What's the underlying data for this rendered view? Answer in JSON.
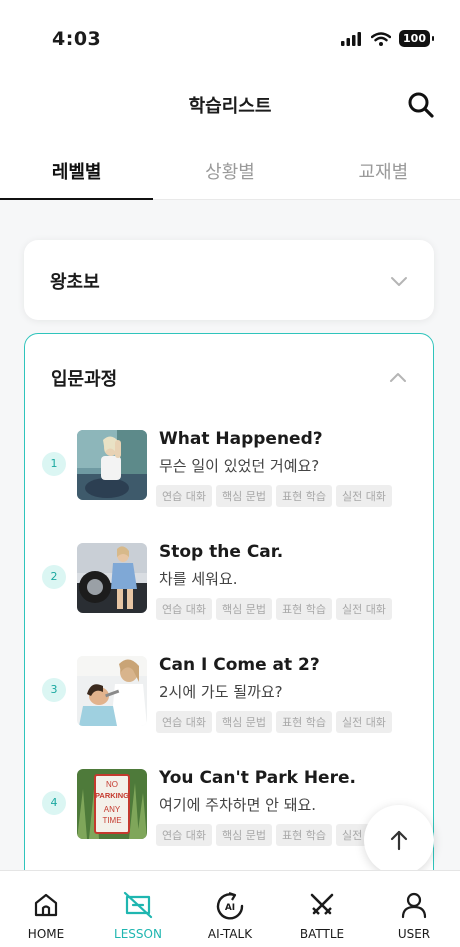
{
  "status_bar": {
    "time": "4:03",
    "battery": "100"
  },
  "header": {
    "title": "학습리스트",
    "search_icon": "search-icon"
  },
  "tabs": [
    {
      "label": "레벨별",
      "active": true
    },
    {
      "label": "상황별",
      "active": false
    },
    {
      "label": "교재별",
      "active": false
    }
  ],
  "sections": [
    {
      "title": "왕초보",
      "expanded": false,
      "icon": "chevron-down-icon"
    },
    {
      "title": "입문과정",
      "expanded": true,
      "icon": "chevron-up-icon"
    }
  ],
  "lessons": [
    {
      "number": "1",
      "title_en": "What Happened?",
      "title_ko": "무슨 일이 있었던 거예요?",
      "image": "woman-at-car-photo"
    },
    {
      "number": "2",
      "title_en": "Stop the Car.",
      "title_ko": "차를 세워요.",
      "image": "woman-by-tire-photo"
    },
    {
      "number": "3",
      "title_en": "Can I Come at 2?",
      "title_ko": "2시에 가도 될까요?",
      "image": "dentist-photo"
    },
    {
      "number": "4",
      "title_en": "You Can't Park Here.",
      "title_ko": "여기에 주차하면 안 돼요.",
      "image": "no-parking-sign-photo"
    }
  ],
  "tags": [
    "연습 대화",
    "핵심 문법",
    "표현 학습",
    "실전 대화"
  ],
  "no_parking_sign": {
    "line1": "NO",
    "line2": "PARKING",
    "line3": "ANY",
    "line4": "TIME"
  },
  "bottom_nav": [
    {
      "label": "HOME",
      "icon": "home-icon",
      "active": false
    },
    {
      "label": "LESSON",
      "icon": "lesson-icon",
      "active": true
    },
    {
      "label": "AI-TALK",
      "icon": "ai-talk-icon",
      "active": false
    },
    {
      "label": "BATTLE",
      "icon": "battle-swords-icon",
      "active": false
    },
    {
      "label": "USER",
      "icon": "user-icon",
      "active": false
    }
  ],
  "colors": {
    "accent": "#2fc4bc",
    "accent_text": "#1fb6b0",
    "tag_bg": "#eeeeee"
  }
}
